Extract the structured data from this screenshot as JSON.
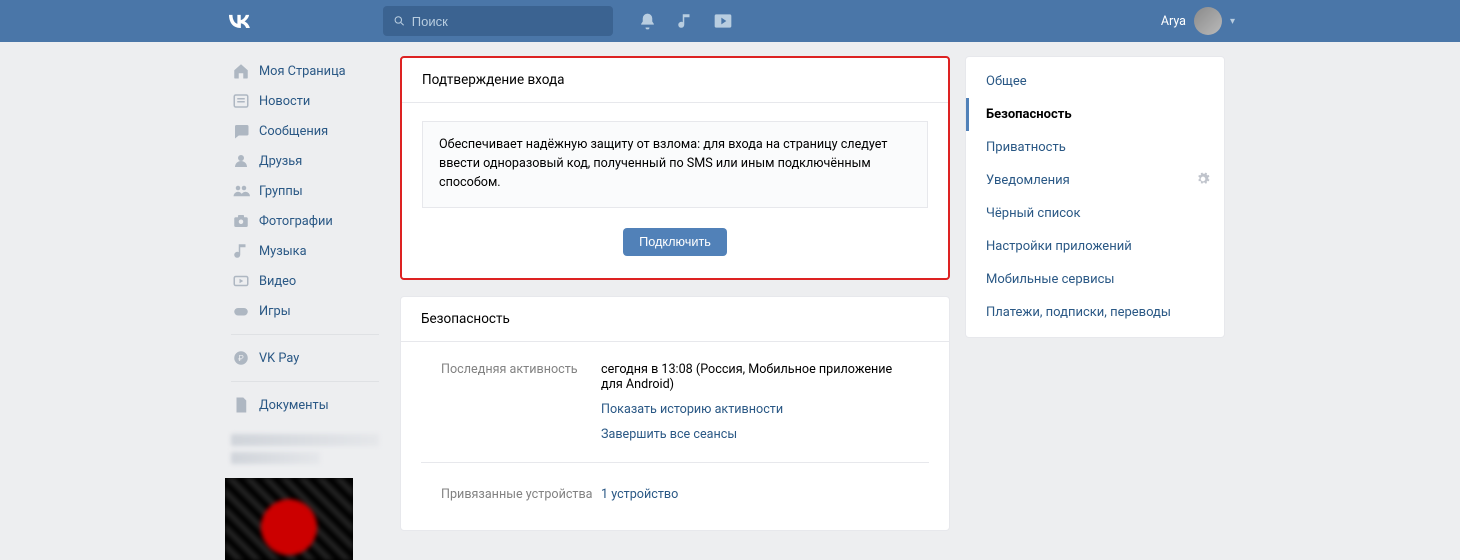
{
  "header": {
    "search_placeholder": "Поиск",
    "username": "Arya"
  },
  "leftnav": {
    "items": [
      {
        "icon": "home",
        "label": "Моя Страница"
      },
      {
        "icon": "news",
        "label": "Новости"
      },
      {
        "icon": "msg",
        "label": "Сообщения"
      },
      {
        "icon": "friends",
        "label": "Друзья"
      },
      {
        "icon": "groups",
        "label": "Группы"
      },
      {
        "icon": "photos",
        "label": "Фотографии"
      },
      {
        "icon": "music",
        "label": "Музыка"
      },
      {
        "icon": "video",
        "label": "Видео"
      },
      {
        "icon": "games",
        "label": "Игры"
      }
    ],
    "pay_label": "VK Pay",
    "docs_label": "Документы"
  },
  "confirm_card": {
    "title": "Подтверждение входа",
    "text": "Обеспечивает надёжную защиту от взлома: для входа на страницу следует ввести одноразовый код, полученный по SMS или иным подключённым способом.",
    "button": "Подключить"
  },
  "security_card": {
    "title": "Безопасность",
    "row1_label": "Последняя активность",
    "row1_value": "сегодня в 13:08 (Россия, Мобильное приложение для Android)",
    "link_history": "Показать историю активности",
    "link_endall": "Завершить все сеансы",
    "row2_label": "Привязанные устройства",
    "row2_value": "1 устройство"
  },
  "rightnav": {
    "items": [
      {
        "label": "Общее",
        "active": false
      },
      {
        "label": "Безопасность",
        "active": true
      },
      {
        "label": "Приватность",
        "active": false
      },
      {
        "label": "Уведомления",
        "active": false,
        "gear": true
      },
      {
        "label": "Чёрный список",
        "active": false
      },
      {
        "label": "Настройки приложений",
        "active": false
      },
      {
        "label": "Мобильные сервисы",
        "active": false
      },
      {
        "label": "Платежи, подписки, переводы",
        "active": false
      }
    ]
  }
}
